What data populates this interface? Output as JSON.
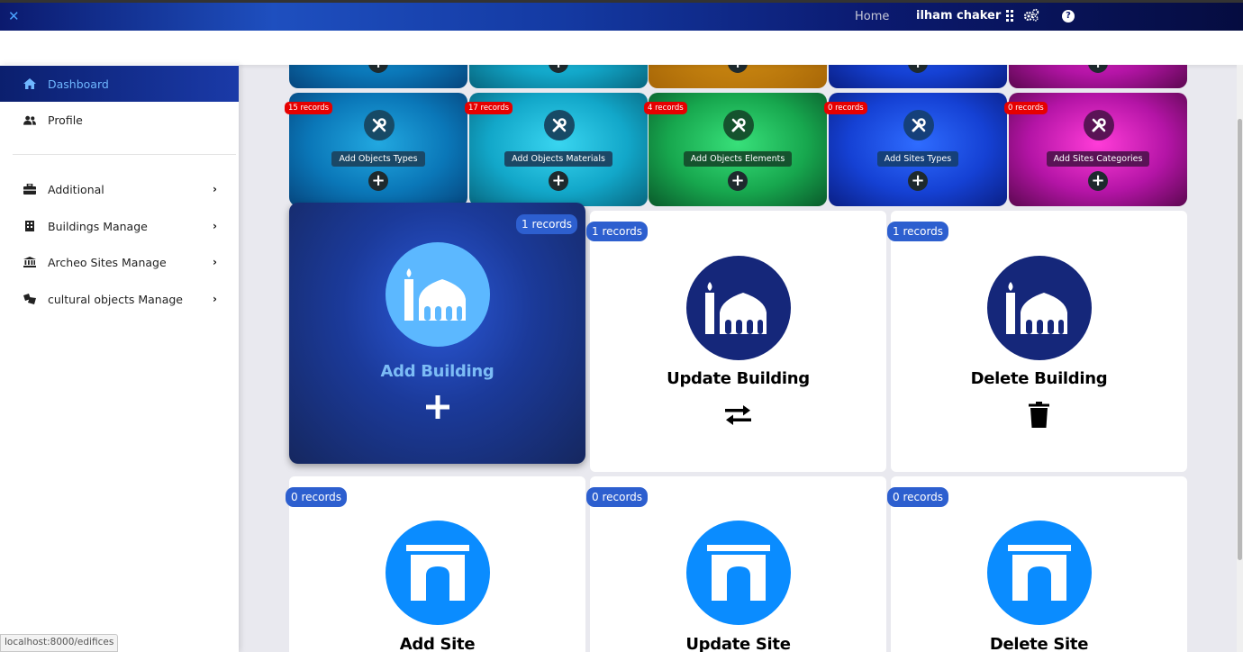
{
  "topbar": {
    "home_label": "Home",
    "user_name": "ilham chaker",
    "icons": [
      "close-icon",
      "apps-grid-icon",
      "cogs-icon",
      "help-icon"
    ]
  },
  "sidebar": {
    "items": [
      {
        "label": "Dashboard",
        "icon": "home-icon",
        "active": true
      },
      {
        "label": "Profile",
        "icon": "users-icon"
      },
      {
        "label": "Additional",
        "icon": "toolbox-icon",
        "chevron": "›"
      },
      {
        "label": "Buildings Manage",
        "icon": "building-icon",
        "chevron": "›"
      },
      {
        "label": "Archeo Sites Manage",
        "icon": "landmark-icon",
        "chevron": "›"
      },
      {
        "label": "cultural objects Manage",
        "icon": "objects-icon",
        "chevron": "›"
      }
    ]
  },
  "tiles": [
    {
      "badge": "15 records",
      "label": "Add Objects Types"
    },
    {
      "badge": "17 records",
      "label": "Add Objects Materials"
    },
    {
      "badge": "4 records",
      "label": "Add Objects Elements"
    },
    {
      "badge": "0 records",
      "label": "Add Sites Types"
    },
    {
      "badge": "0 records",
      "label": "Add Sites Categories"
    }
  ],
  "building_cards": [
    {
      "records": "1 records",
      "title": "Add Building",
      "action_icon": "plus-icon"
    },
    {
      "records": "1 records",
      "title": "Update Building",
      "action_icon": "exchange-icon"
    },
    {
      "records": "1 records",
      "title": "Delete Building",
      "action_icon": "trash-icon"
    }
  ],
  "site_cards": [
    {
      "records": "0 records",
      "title": "Add Site"
    },
    {
      "records": "0 records",
      "title": "Update Site"
    },
    {
      "records": "0 records",
      "title": "Delete Site"
    }
  ],
  "status_url": "localhost:8000/edifices",
  "colors": {
    "accent_blue": "#2d5fcf",
    "badge_red": "#e60000",
    "mosque_dark": "#15277a",
    "mosque_light": "#5cb8ff",
    "arch_blue": "#0a8cff"
  }
}
